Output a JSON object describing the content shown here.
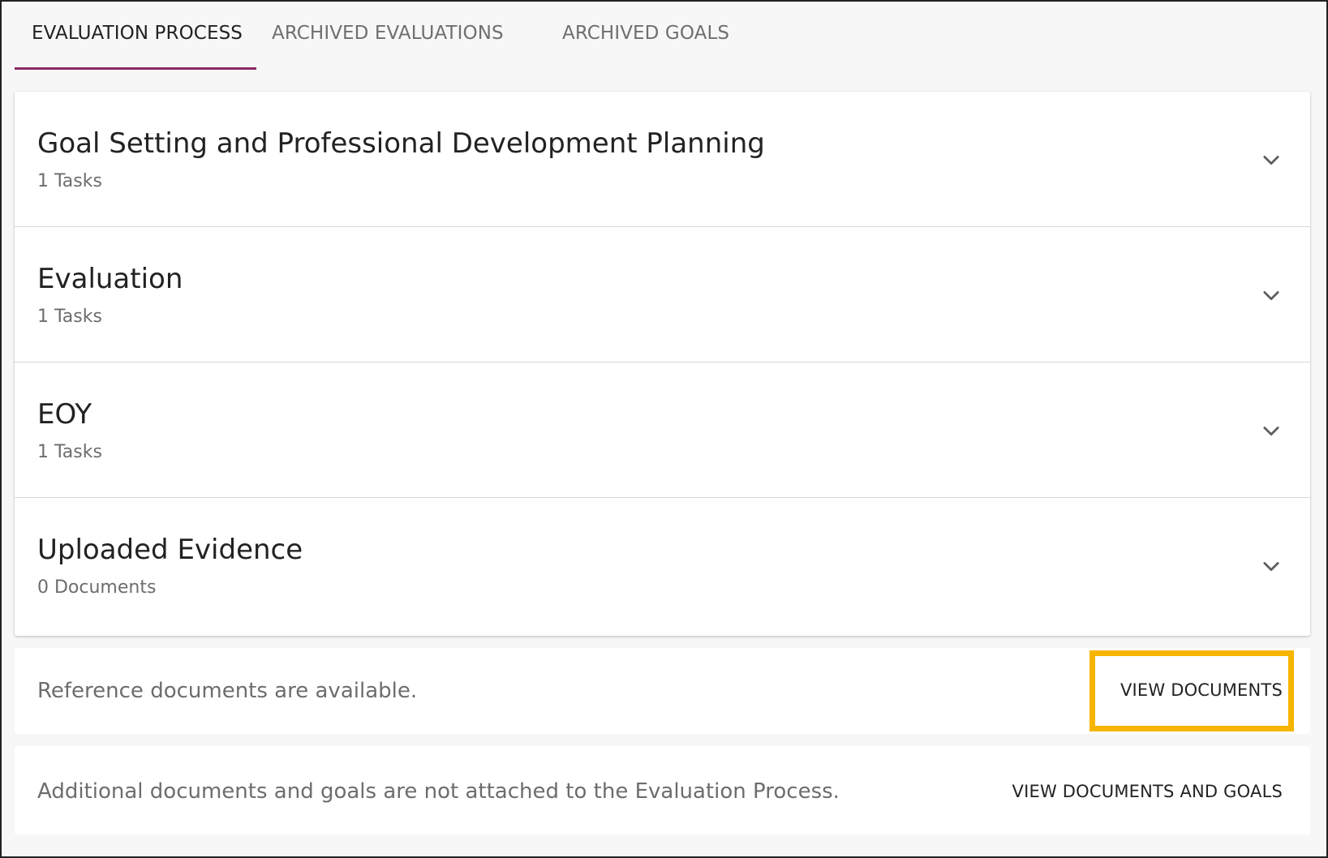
{
  "tabs": [
    {
      "label": "EVALUATION PROCESS",
      "active": true
    },
    {
      "label": "ARCHIVED EVALUATIONS",
      "active": false
    },
    {
      "label": "ARCHIVED GOALS",
      "active": false
    }
  ],
  "sections": [
    {
      "title": "Goal Setting and Professional Development Planning",
      "count": "1 Tasks",
      "icon": "chevron-down-icon"
    },
    {
      "title": "Evaluation",
      "count": "1 Tasks",
      "icon": "chevron-down-icon"
    },
    {
      "title": "EOY",
      "count": "1 Tasks",
      "icon": "chevron-down-icon"
    },
    {
      "title": "Uploaded Evidence",
      "count": "0 Documents",
      "icon": "chevron-down-icon"
    }
  ],
  "reference_card": {
    "text": "Reference documents are available.",
    "button_label": "VIEW DOCUMENTS"
  },
  "additional_card": {
    "text": "Additional documents and goals are not attached to the Evaluation Process.",
    "button_label": "VIEW DOCUMENTS AND GOALS"
  },
  "colors": {
    "accent": "#8a2a63",
    "highlight": "#f7b500",
    "background": "#f7f7f7"
  }
}
